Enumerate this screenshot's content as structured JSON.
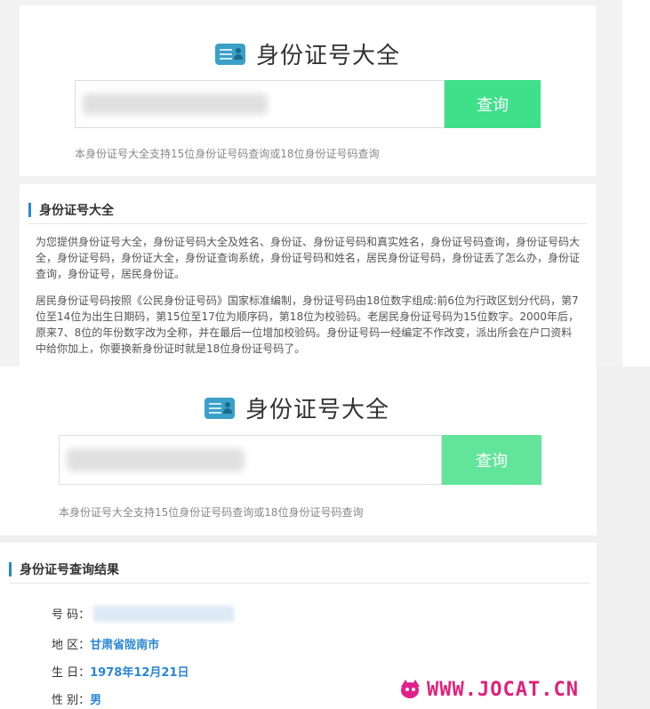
{
  "top": {
    "title": "身份证号大全",
    "search_button": "查询",
    "hint": "本身份证号大全支持15位身份证号码查询或18位身份证号码查询"
  },
  "about": {
    "heading": "身份证号大全",
    "para1": "为您提供身份证号大全，身份证号码大全及姓名、身份证、身份证号码和真实姓名，身份证号码查询，身份证号码大全，身份证号码，身份证大全，身份证查询系统，身份证号码和姓名，居民身份证号码，身份证丢了怎么办，身份证查询，身份证号，居民身份证。",
    "para2": "居民身份证号码按照《公民身份证号码》国家标准编制，身份证号码由18位数字组成:前6位为行政区划分代码，第7位至14位为出生日期码，第15位至17位为顺序码，第18位为校验码。老居民身份证号码为15位数字。2000年后，原来7、8位的年份数字改为全称，并在最后一位增加校验码。身份证号码一经编定不作改变，派出所会在户口资料中给你加上，你要换新身份证时就是18位身份证号码了。"
  },
  "second": {
    "title": "身份证号大全",
    "search_button": "查询",
    "hint": "本身份证号大全支持15位身份证号码查询或18位身份证号码查询"
  },
  "result": {
    "heading": "身份证号查询结果",
    "number_label": "号 码：",
    "region_label": "地 区：",
    "region_value": "甘肃省陇南市",
    "birth_label": "生 日：",
    "birth_value": "1978年12月21日",
    "gender_label": "性 别：",
    "gender_value": "男"
  },
  "watermark": "WWW.JOCAT.CN",
  "colors": {
    "button_green": "#3fe08a",
    "button_green_light": "#62e59b",
    "accent_blue": "#2a86d4",
    "watermark_pink": "#e0217a"
  }
}
